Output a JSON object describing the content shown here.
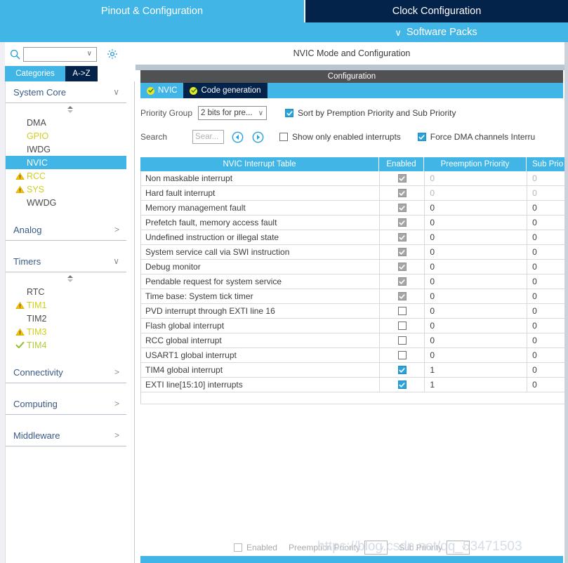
{
  "window": {
    "top_tabs": [
      {
        "label": "Pinout & Configuration",
        "active": true
      },
      {
        "label": "Clock Configuration",
        "active": false
      }
    ],
    "software_packs": "Software Packs",
    "chevron_down_glyph": "∨"
  },
  "sidebar": {
    "search": {
      "value": "",
      "placeholder": ""
    },
    "category_tabs": [
      {
        "label": "Categories",
        "active": true
      },
      {
        "label": "A->Z",
        "active": false
      }
    ],
    "groups": [
      {
        "title": "System Core",
        "expanded": true,
        "chevron": "∨",
        "items": [
          {
            "label": "DMA",
            "state": "normal",
            "icon": "none"
          },
          {
            "label": "GPIO",
            "state": "configured",
            "icon": "none"
          },
          {
            "label": "IWDG",
            "state": "normal",
            "icon": "none"
          },
          {
            "label": "NVIC",
            "state": "selected",
            "icon": "none"
          },
          {
            "label": "RCC",
            "state": "configured",
            "icon": "warning-icon"
          },
          {
            "label": "SYS",
            "state": "configured",
            "icon": "warning-icon"
          },
          {
            "label": "WWDG",
            "state": "normal",
            "icon": "none"
          }
        ]
      },
      {
        "title": "Analog",
        "expanded": false,
        "chevron": ">",
        "items": []
      },
      {
        "title": "Timers",
        "expanded": true,
        "chevron": "∨",
        "items": [
          {
            "label": "RTC",
            "state": "normal",
            "icon": "none"
          },
          {
            "label": "TIM1",
            "state": "configured",
            "icon": "warning-icon"
          },
          {
            "label": "TIM2",
            "state": "normal",
            "icon": "none"
          },
          {
            "label": "TIM3",
            "state": "configured",
            "icon": "warning-icon"
          },
          {
            "label": "TIM4",
            "state": "ok",
            "icon": "check-icon"
          }
        ]
      },
      {
        "title": "Connectivity",
        "expanded": false,
        "chevron": ">",
        "items": []
      },
      {
        "title": "Computing",
        "expanded": false,
        "chevron": ">",
        "items": []
      },
      {
        "title": "Middleware",
        "expanded": false,
        "chevron": ">",
        "items": []
      }
    ]
  },
  "main": {
    "mode_title": "NVIC Mode and Configuration",
    "configuration_bar": "Configuration",
    "sub_tabs": [
      {
        "label": "NVIC",
        "active": true
      },
      {
        "label": "Code generation",
        "active": false
      }
    ],
    "controls": {
      "priority_group_label": "Priority Group",
      "priority_group_value": "2 bits for pre...",
      "sort_checkbox_label": "Sort by Premption Priority and Sub Priority",
      "sort_checkbox_checked": true,
      "search_label": "Search",
      "search_value": "",
      "search_placeholder": "Sear...",
      "prev_button": "prev-search-icon",
      "next_button": "next-search-icon",
      "show_only_enabled_label": "Show only enabled interrupts",
      "show_only_enabled_checked": false,
      "force_dma_label": "Force DMA channels Interru",
      "force_dma_checked": true,
      "caret_glyph": "∨"
    },
    "table": {
      "columns": [
        "NVIC Interrupt Table",
        "Enabled",
        "Preemption Priority",
        "Sub Prio"
      ],
      "rows": [
        {
          "name": "Non maskable interrupt",
          "enabled": true,
          "locked": true,
          "preemption": "0",
          "sub": "0",
          "dim": true
        },
        {
          "name": "Hard fault interrupt",
          "enabled": true,
          "locked": true,
          "preemption": "0",
          "sub": "0",
          "dim": true
        },
        {
          "name": "Memory management fault",
          "enabled": true,
          "locked": true,
          "preemption": "0",
          "sub": "0",
          "dim": false
        },
        {
          "name": "Prefetch fault, memory access fault",
          "enabled": true,
          "locked": true,
          "preemption": "0",
          "sub": "0",
          "dim": false
        },
        {
          "name": "Undefined instruction or illegal state",
          "enabled": true,
          "locked": true,
          "preemption": "0",
          "sub": "0",
          "dim": false
        },
        {
          "name": "System service call via SWI instruction",
          "enabled": true,
          "locked": true,
          "preemption": "0",
          "sub": "0",
          "dim": false
        },
        {
          "name": "Debug monitor",
          "enabled": true,
          "locked": true,
          "preemption": "0",
          "sub": "0",
          "dim": false
        },
        {
          "name": "Pendable request for system service",
          "enabled": true,
          "locked": true,
          "preemption": "0",
          "sub": "0",
          "dim": false
        },
        {
          "name": "Time base: System tick timer",
          "enabled": true,
          "locked": true,
          "preemption": "0",
          "sub": "0",
          "dim": false
        },
        {
          "name": "PVD interrupt through EXTI line 16",
          "enabled": false,
          "locked": false,
          "preemption": "0",
          "sub": "0",
          "dim": false
        },
        {
          "name": "Flash global interrupt",
          "enabled": false,
          "locked": false,
          "preemption": "0",
          "sub": "0",
          "dim": false
        },
        {
          "name": "RCC global interrupt",
          "enabled": false,
          "locked": false,
          "preemption": "0",
          "sub": "0",
          "dim": false
        },
        {
          "name": "USART1 global interrupt",
          "enabled": false,
          "locked": false,
          "preemption": "0",
          "sub": "0",
          "dim": false
        },
        {
          "name": "TIM4 global interrupt",
          "enabled": true,
          "locked": false,
          "preemption": "1",
          "sub": "0",
          "dim": false
        },
        {
          "name": "EXTI line[15:10] interrupts",
          "enabled": true,
          "locked": false,
          "preemption": "1",
          "sub": "0",
          "dim": false
        }
      ]
    },
    "footer": {
      "enabled_label": "Enabled",
      "enabled_checked": false,
      "preemption_label": "Preemption Priority",
      "preemption_value": "",
      "sub_label": "Sub Priority",
      "sub_value": "",
      "caret_glyph": "∨"
    }
  },
  "watermark": "https://blog.csdn.net/qq_53471503",
  "colors": {
    "accent_blue": "#41b6e6",
    "dark_navy": "#03234b",
    "selected_row": "#41b6e6",
    "warning_yellow": "#f2c300",
    "configured_yellow": "#cfcf1d",
    "ok_green": "#b2cc34",
    "config_bar_gray": "#4f5152",
    "grayblue_strip": "#b9c5d0"
  }
}
